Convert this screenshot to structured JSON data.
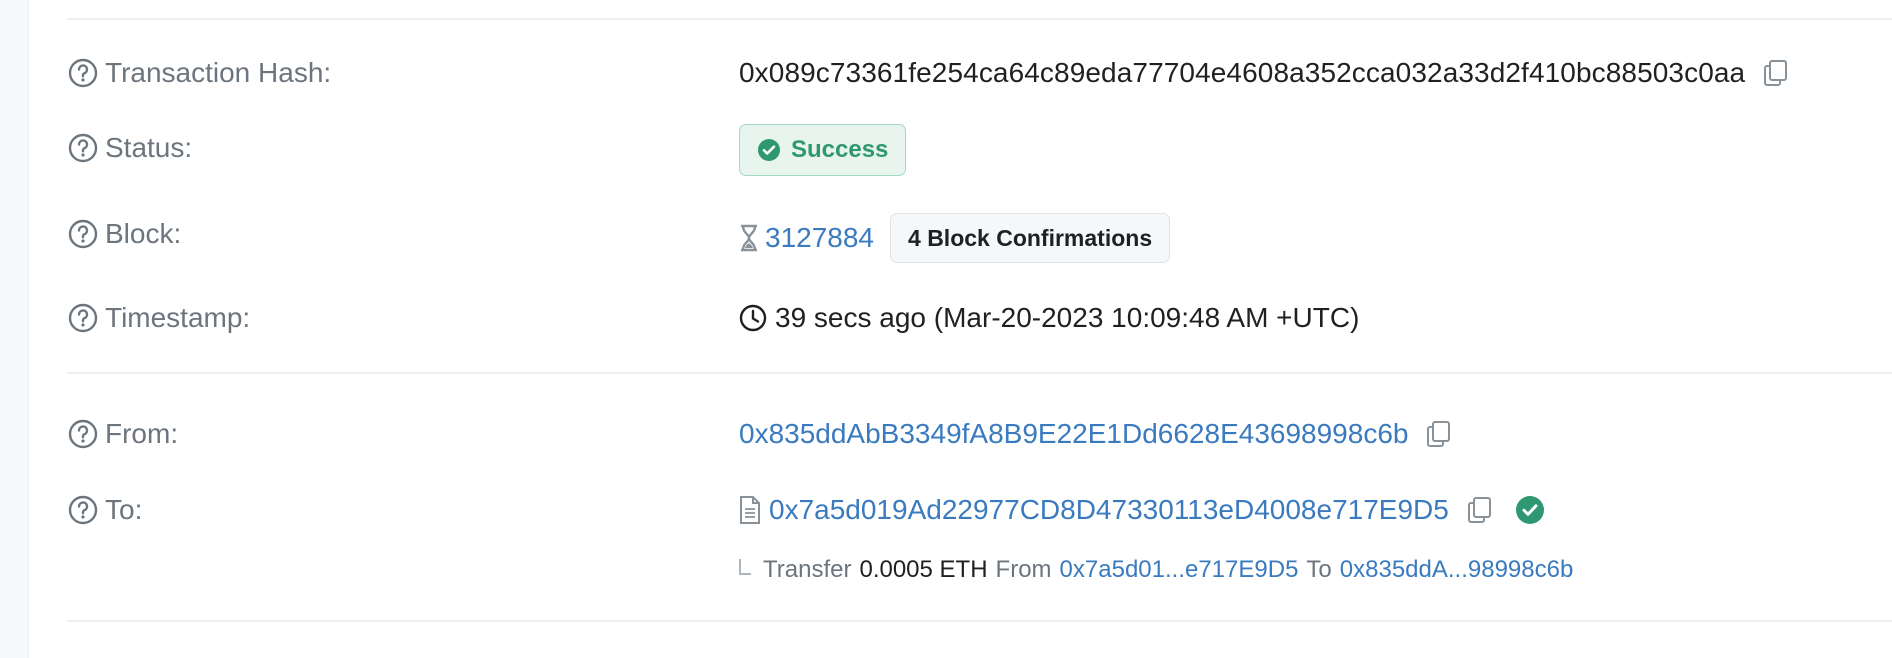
{
  "transaction": {
    "hash_label": "Transaction Hash:",
    "hash_value": "0x089c73361fe254ca64c89eda77704e4608a352cca032a33d2f410bc88503c0aa",
    "status_label": "Status:",
    "status_value": "Success",
    "block_label": "Block:",
    "block_number": "3127884",
    "block_confirmations": "4 Block Confirmations",
    "timestamp_label": "Timestamp:",
    "timestamp_value": "39 secs ago (Mar-20-2023 10:09:48 AM +UTC)",
    "from_label": "From:",
    "from_address": "0x835ddAbB3349fA8B9E22E1Dd6628E43698998c6b",
    "to_label": "To:",
    "to_address": "0x7a5d019Ad22977CD8D47330113eD4008e717E9D5"
  },
  "transfer": {
    "word_transfer": "Transfer",
    "amount": "0.0005 ETH",
    "word_from": "From",
    "from_short": "0x7a5d01...e717E9D5",
    "word_to": "To",
    "to_short": "0x835ddA...98998c6b"
  },
  "icons": {
    "help": "help-circle-icon",
    "copy": "copy-icon",
    "success": "check-circle-icon",
    "hourglass": "hourglass-icon",
    "clock": "clock-icon",
    "contract": "contract-file-icon",
    "verified": "verified-check-icon"
  },
  "colors": {
    "link": "#3a7abf",
    "success_text": "#2f9771",
    "success_bg": "#e8f5ef",
    "label": "#6c757d",
    "text": "#1e2022"
  }
}
